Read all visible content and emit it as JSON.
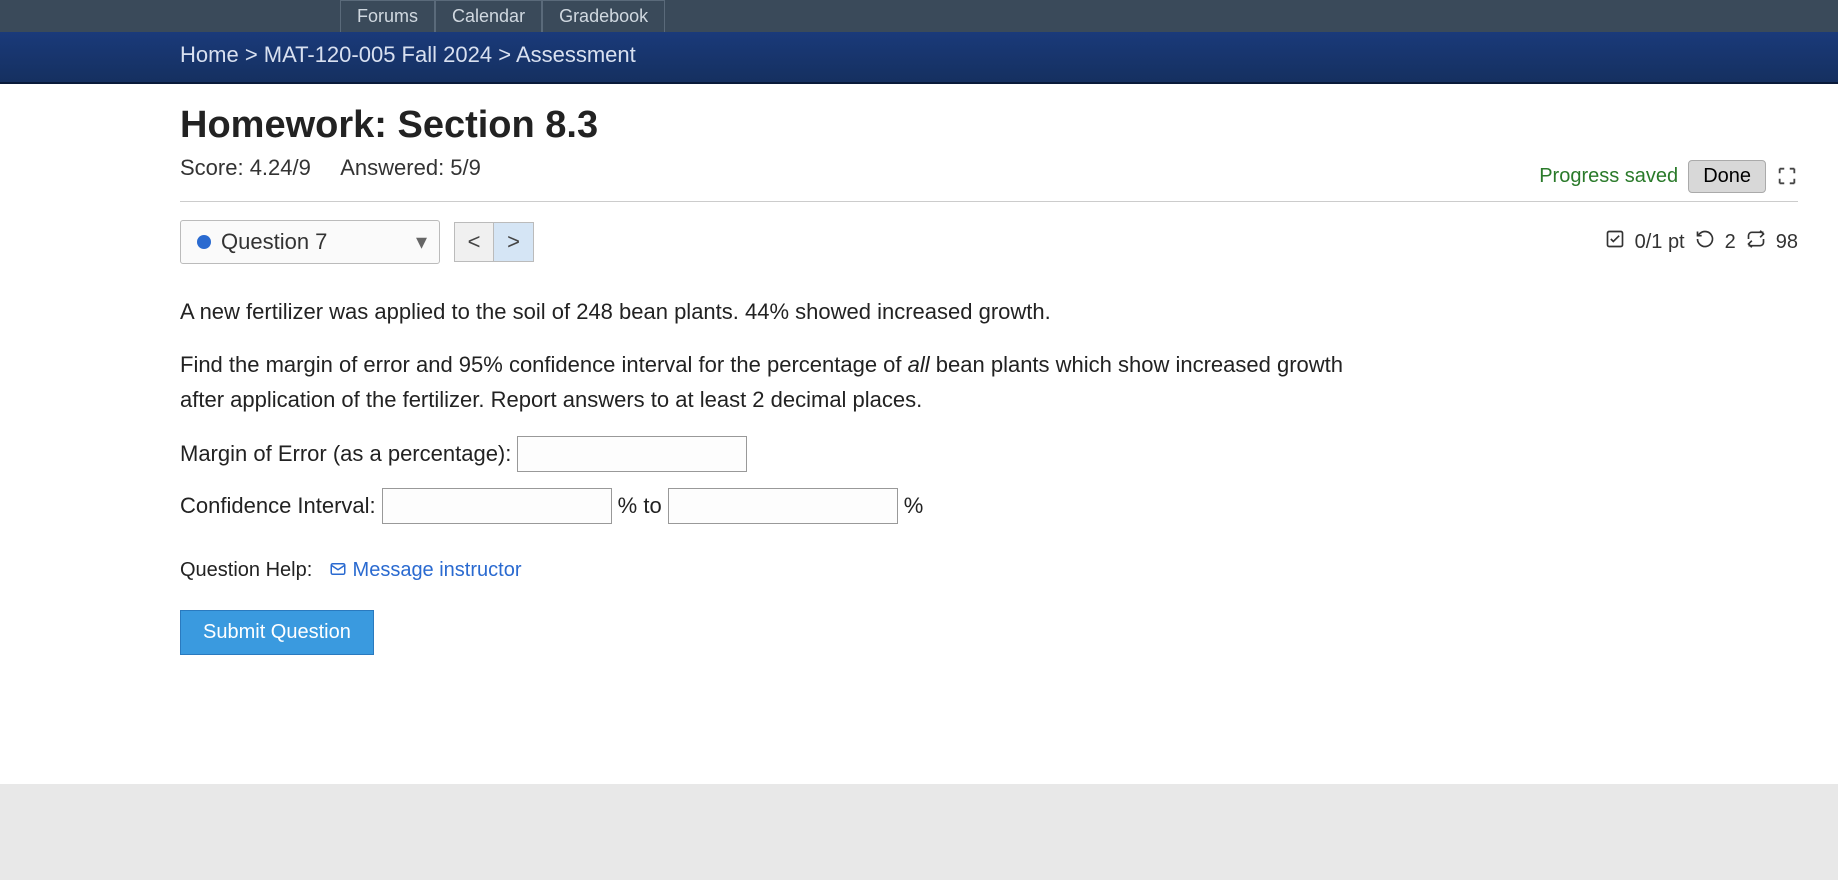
{
  "tabs": {
    "forums": "Forums",
    "calendar": "Calendar",
    "gradebook": "Gradebook"
  },
  "breadcrumb": {
    "home": "Home",
    "course": "MAT-120-005 Fall 2024",
    "page": "Assessment"
  },
  "header": {
    "title": "Homework: Section 8.3",
    "score_label": "Score: 4.24/9",
    "answered_label": "Answered: 5/9",
    "progress_saved": "Progress saved",
    "done": "Done"
  },
  "question_nav": {
    "label": "Question 7",
    "prev": "<",
    "next": ">"
  },
  "points": {
    "check_alt": "scored",
    "pts": "0/1 pt",
    "retry_count": "2",
    "attempt_count": "98"
  },
  "question": {
    "p1": "A new fertilizer was applied to the soil of 248 bean plants. 44% showed increased growth.",
    "p2a": "Find the margin of error and 95% confidence interval for the percentage of ",
    "p2_em": "all",
    "p2b": " bean plants which show increased growth after application of the fertilizer. Report answers to at least 2 decimal places.",
    "moe_label": "Margin of Error (as a percentage):",
    "ci_label": "Confidence Interval:",
    "pct_to": "% to",
    "pct": "%"
  },
  "help": {
    "label": "Question Help:",
    "link": "Message instructor"
  },
  "submit": "Submit Question"
}
